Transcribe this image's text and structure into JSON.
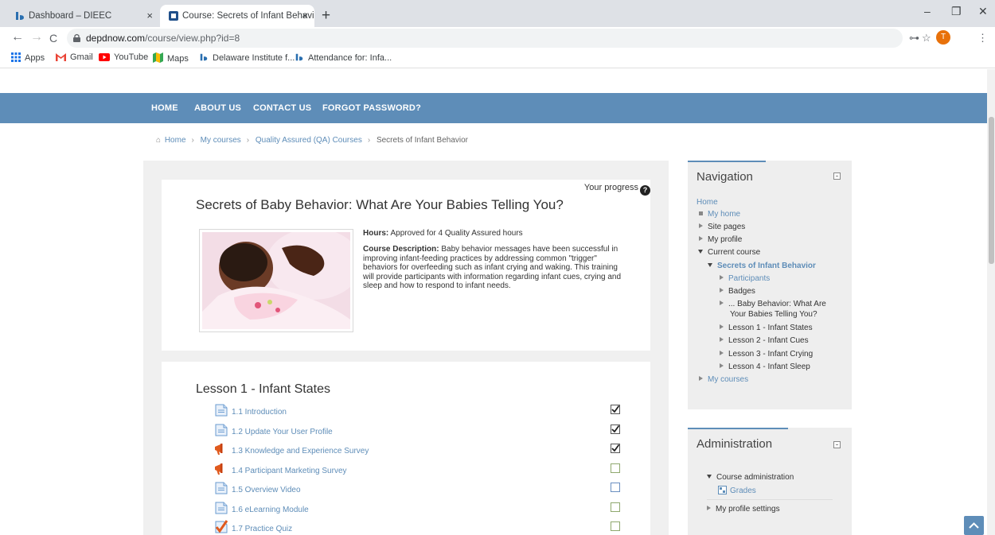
{
  "browser": {
    "tabs": [
      {
        "title": "Dashboard – DIEEC",
        "close": "×"
      },
      {
        "title": "Course: Secrets of Infant Behavio",
        "close": "×"
      }
    ],
    "new_tab": "+",
    "window_controls": {
      "minimize": "–",
      "restore": "❐",
      "close": "✕"
    },
    "nav": {
      "back": "←",
      "forward": "→",
      "reload": "C"
    },
    "url_host": "depdnow.com",
    "url_path": "/course/view.php?id=8",
    "profile_initial": "T",
    "bookmarks": [
      {
        "label": "Apps"
      },
      {
        "label": "Gmail"
      },
      {
        "label": "YouTube"
      },
      {
        "label": "Maps"
      },
      {
        "label": "Delaware Institute f..."
      },
      {
        "label": "Attendance for: Infa..."
      }
    ]
  },
  "site_nav": [
    "HOME",
    "ABOUT US",
    "CONTACT US",
    "FORGOT PASSWORD?"
  ],
  "breadcrumb": [
    "Home",
    "My courses",
    "Quality Assured (QA) Courses",
    "Secrets of Infant Behavior"
  ],
  "course": {
    "progress_label": "Your progress",
    "title": "Secrets of Baby Behavior: What Are Your Babies Telling You?",
    "hours_label": "Hours:",
    "hours_text": "Approved for 4 Quality Assured hours",
    "desc_label": "Course Description:",
    "desc_text": "Baby behavior messages have been successful in improving infant-feeding practices by addressing common \"trigger\" behaviors for overfeeding such as infant crying and waking. This training will provide participants with information regarding infant cues, crying and sleep and how to respond to infant needs."
  },
  "lesson": {
    "title": "Lesson 1 - Infant States",
    "activities": [
      {
        "label": "1.1 Introduction",
        "icon": "page-icon",
        "complete": true
      },
      {
        "label": "1.2 Update Your User Profile",
        "icon": "page-icon",
        "complete": true
      },
      {
        "label": "1.3 Knowledge and Experience Survey",
        "icon": "feedback-icon",
        "complete": true
      },
      {
        "label": "1.4 Participant Marketing Survey",
        "icon": "feedback-icon",
        "complete": false
      },
      {
        "label": "1.5 Overview Video",
        "icon": "page-icon",
        "complete": false
      },
      {
        "label": "1.6 eLearning Module",
        "icon": "page-icon",
        "complete": false
      },
      {
        "label": "1.7 Practice Quiz",
        "icon": "quiz-icon",
        "complete": false
      }
    ]
  },
  "navigation_block": {
    "title": "Navigation",
    "home": "Home",
    "my_home": "My home",
    "site_pages": "Site pages",
    "my_profile": "My profile",
    "current_course": "Current course",
    "course_name": "Secrets of Infant Behavior",
    "participants": "Participants",
    "badges": "Badges",
    "section_line1": "... Baby Behavior: What Are",
    "section_line2": "Your Babies Telling You?",
    "lessons": [
      "Lesson 1 - Infant States",
      "Lesson 2 - Infant Cues",
      "Lesson 3 - Infant Crying",
      "Lesson 4 - Infant Sleep"
    ],
    "my_courses": "My courses"
  },
  "admin_block": {
    "title": "Administration",
    "course_admin": "Course administration",
    "grades": "Grades",
    "profile_settings": "My profile settings"
  },
  "colors": {
    "accent": "#5e8db8",
    "tabbar": "#dee1e6",
    "profile": "#e8710a"
  }
}
